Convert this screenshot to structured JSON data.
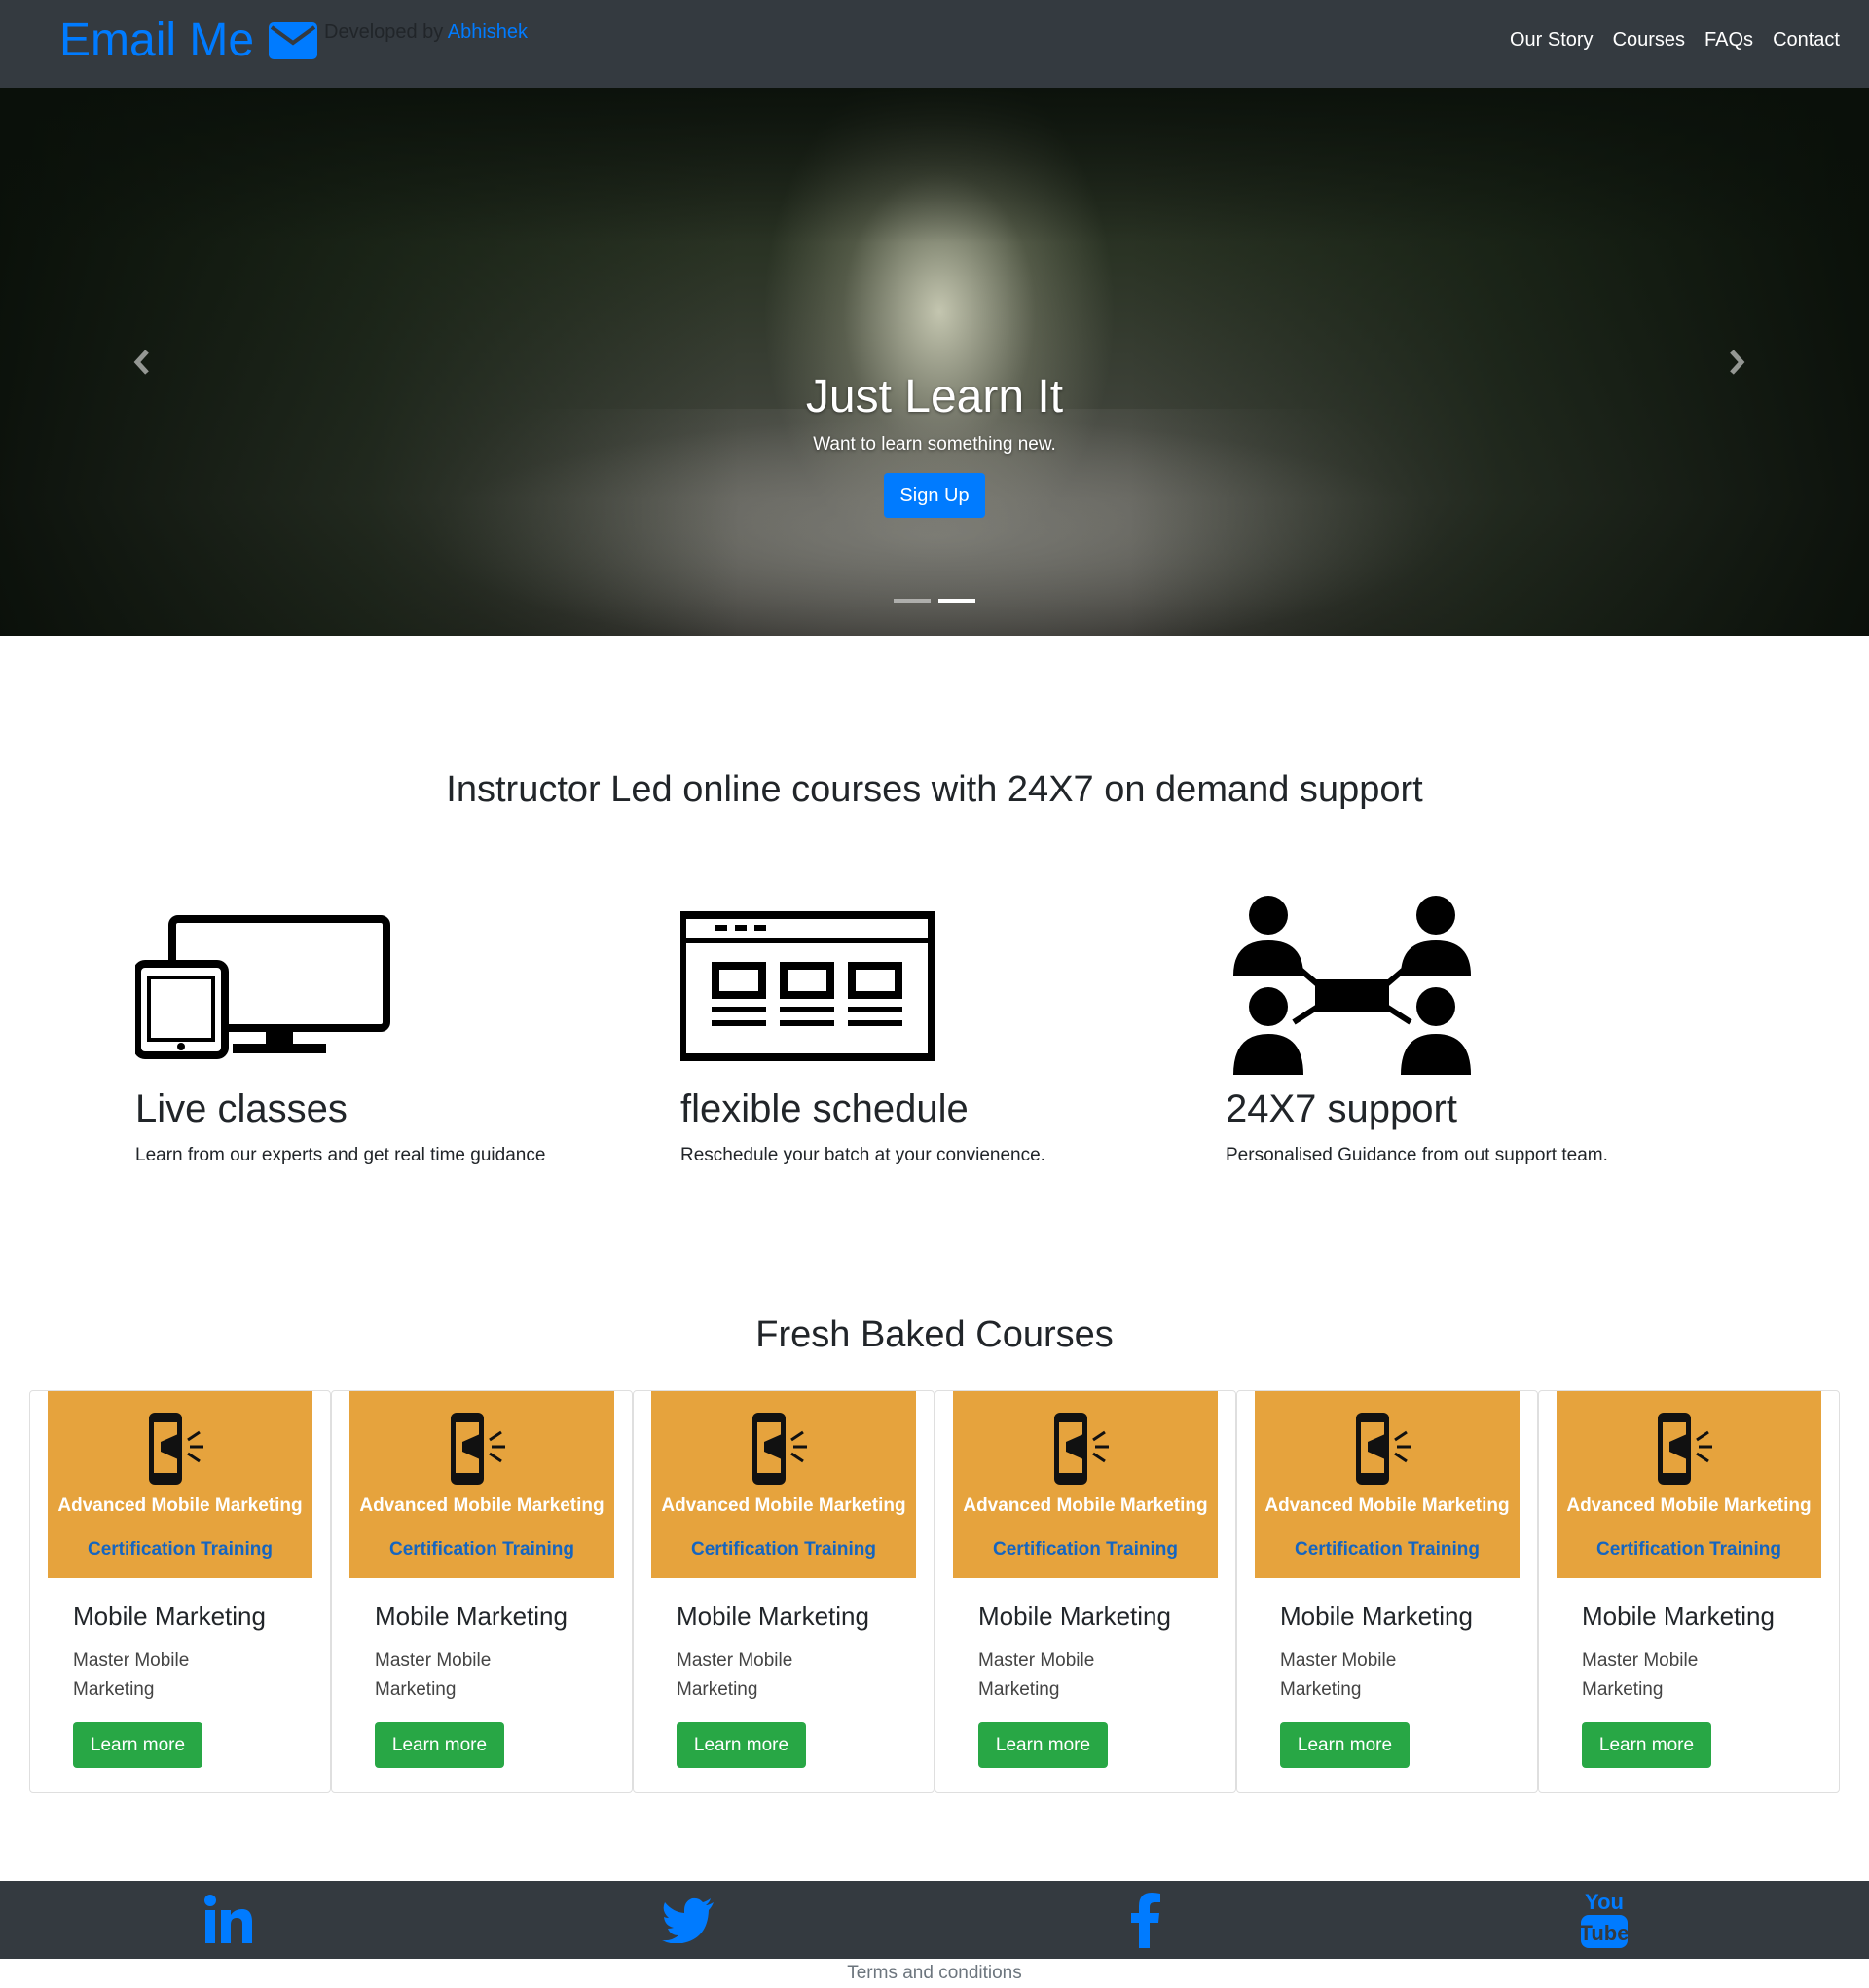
{
  "navbar": {
    "brand": "Email Me",
    "brand_icon": "envelope-icon",
    "developed_by": "Developed by",
    "developer": "Abhishek",
    "links": [
      "Our Story",
      "Courses",
      "FAQs",
      "Contact"
    ]
  },
  "hero": {
    "title": "Just Learn It",
    "subtitle": "Want to learn something new.",
    "button": "Sign Up",
    "prev_icon": "chevron-left-icon",
    "next_icon": "chevron-right-icon",
    "slides_count": 2,
    "active_slide": 2
  },
  "features": {
    "heading": "Instructor Led online courses with 24X7 on demand support",
    "items": [
      {
        "icon": "devices-icon",
        "title": "Live classes",
        "text": "Learn from our experts and get real time guidance"
      },
      {
        "icon": "schedule-icon",
        "title": "flexible schedule",
        "text": "Reschedule your batch at your convienence."
      },
      {
        "icon": "support-network-icon",
        "title": "24X7 support",
        "text": "Personalised Guidance from out support team."
      }
    ]
  },
  "courses": {
    "heading": "Fresh Baked Courses",
    "items": [
      {
        "image_title": "Advanced Mobile Marketing",
        "image_subtitle": "Certification Training",
        "title": "Mobile Marketing",
        "text": "Master Mobile Marketing",
        "button": "Learn more"
      },
      {
        "image_title": "Advanced Mobile Marketing",
        "image_subtitle": "Certification Training",
        "title": "Mobile Marketing",
        "text": "Master Mobile Marketing",
        "button": "Learn more"
      },
      {
        "image_title": "Advanced Mobile Marketing",
        "image_subtitle": "Certification Training",
        "title": "Mobile Marketing",
        "text": "Master Mobile Marketing",
        "button": "Learn more"
      },
      {
        "image_title": "Advanced Mobile Marketing",
        "image_subtitle": "Certification Training",
        "title": "Mobile Marketing",
        "text": "Master Mobile Marketing",
        "button": "Learn more"
      },
      {
        "image_title": "Advanced Mobile Marketing",
        "image_subtitle": "Certification Training",
        "title": "Mobile Marketing",
        "text": "Master Mobile Marketing",
        "button": "Learn more"
      },
      {
        "image_title": "Advanced Mobile Marketing",
        "image_subtitle": "Certification Training",
        "title": "Mobile Marketing",
        "text": "Master Mobile Marketing",
        "button": "Learn more"
      }
    ]
  },
  "footer": {
    "social_icons": [
      "linkedin-icon",
      "twitter-icon",
      "facebook-icon",
      "youtube-icon"
    ],
    "terms": "Terms and conditions"
  },
  "colors": {
    "navbar_bg": "#343a40",
    "brand": "#007bff",
    "primary_button": "#28a745",
    "signup_button": "#007bff",
    "card_image_bg": "#e6a33d"
  }
}
